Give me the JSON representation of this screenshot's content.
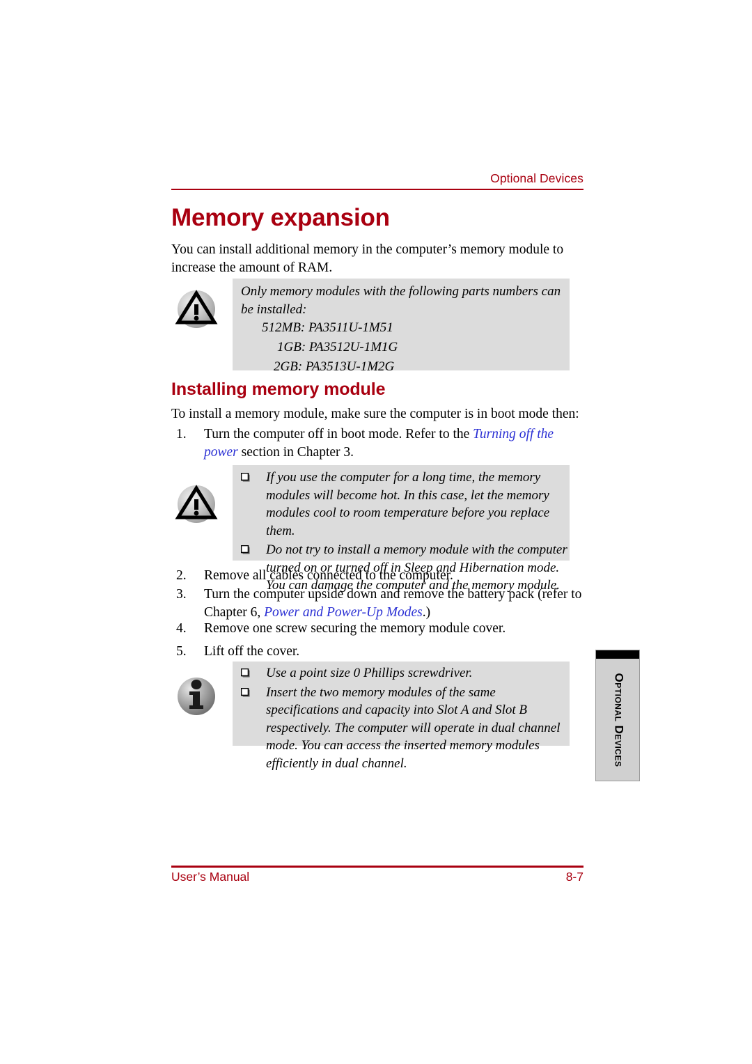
{
  "header": {
    "running_head": "Optional Devices",
    "rule_color": "#A90010"
  },
  "headings": {
    "h1": "Memory expansion",
    "h2": "Installing memory module"
  },
  "paragraphs": {
    "intro": "You can install additional memory in the computer’s memory module to increase the amount of RAM.",
    "lead": "To install a memory module, make sure the computer is in boot mode then:"
  },
  "callout_parts": {
    "icon": "warning-triangle-icon",
    "text": "Only memory modules with the following parts numbers can be installed:",
    "parts": [
      "512MB: PA3511U-1M51",
      "1GB: PA3512U-1M1G",
      "2GB: PA3513U-1M2G"
    ]
  },
  "steps": [
    {
      "number": "1.",
      "pre": "Turn the computer off in boot mode. Refer to the ",
      "xref": "Turning off the power",
      "post": " section in Chapter 3."
    },
    {
      "number": "2.",
      "pre": "Remove all cables connected to the computer.",
      "xref": "",
      "post": ""
    },
    {
      "number": "3.",
      "pre": "Turn the computer upside down and remove the battery pack (refer to Chapter 6, ",
      "xref": "Power and Power-Up Modes",
      "post": ".)"
    },
    {
      "number": "4.",
      "pre": "Remove one screw securing the memory module cover.",
      "xref": "",
      "post": ""
    },
    {
      "number": "5.",
      "pre": "Lift off the cover.",
      "xref": "",
      "post": ""
    }
  ],
  "callout_hot": {
    "icon": "warning-triangle-icon",
    "bullets": [
      "If you use the computer for a long time, the memory modules will become hot. In this case, let the memory modules cool to room temperature before you replace them.",
      "Do not try to install a memory module with the computer turned on or turned off in Sleep and Hibernation mode. You can damage the computer and the memory module."
    ]
  },
  "callout_info": {
    "icon": "info-circle-icon",
    "bullets": [
      "Use a point size 0 Phillips screwdriver.",
      "Insert the two memory modules of the same specifications and capacity into Slot A and Slot B respectively. The computer will operate in dual channel mode. You can access the inserted memory modules efficiently in dual channel."
    ]
  },
  "side_tab": {
    "label": "Optional Devices"
  },
  "footer": {
    "left": "User’s Manual",
    "right": "8-7"
  },
  "colors": {
    "brand_red": "#A90010",
    "xref_blue": "#2B30D4",
    "callout_gray": "#DCDCDC",
    "tab_gray": "#D0D0D0"
  }
}
